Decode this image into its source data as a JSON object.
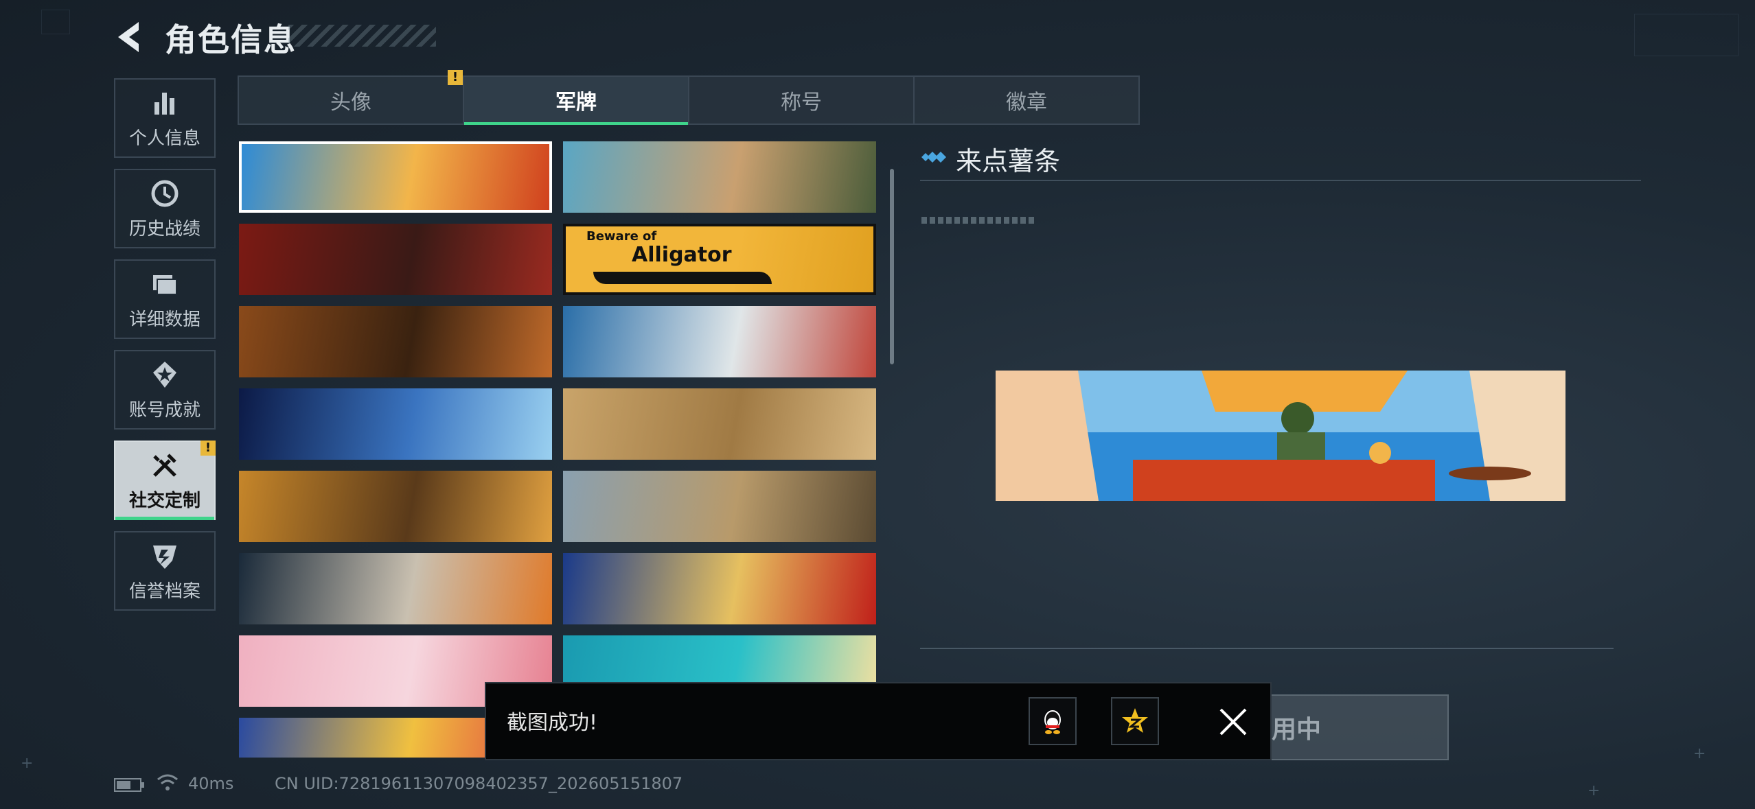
{
  "header": {
    "title": "角色信息"
  },
  "sidebar": {
    "items": [
      {
        "label": "个人信息",
        "icon": "bar-chart-icon"
      },
      {
        "label": "历史战绩",
        "icon": "history-icon"
      },
      {
        "label": "详细数据",
        "icon": "folder-icon"
      },
      {
        "label": "账号成就",
        "icon": "achievement-icon"
      },
      {
        "label": "社交定制",
        "icon": "tools-icon",
        "active": true,
        "alert": "!"
      },
      {
        "label": "信誉档案",
        "icon": "credit-icon"
      }
    ]
  },
  "tabs": [
    {
      "label": "头像",
      "alert": "!"
    },
    {
      "label": "军牌",
      "active": true
    },
    {
      "label": "称号"
    },
    {
      "label": "徽章"
    }
  ],
  "banners": [
    {
      "name": "food-vendor",
      "colors": [
        "#2e8bd6",
        "#f2b54a",
        "#d0411e"
      ]
    },
    {
      "name": "girl-with-gun",
      "colors": [
        "#5aa6c4",
        "#c9a070",
        "#4a5c3a"
      ]
    },
    {
      "name": "red-squad",
      "colors": [
        "#7c1a14",
        "#3a1a16",
        "#9a2a20"
      ]
    },
    {
      "name": "alligator",
      "colors": [
        "#f2b63a",
        "#f2b63a",
        "#e0a020"
      ],
      "line1": "Beware of",
      "line2": "Alligator"
    },
    {
      "name": "autumn-skeleton",
      "colors": [
        "#8a4a1a",
        "#3a2210",
        "#c06a2a"
      ]
    },
    {
      "name": "octopus-wave",
      "colors": [
        "#2a6ea8",
        "#e0e6e8",
        "#c0453a"
      ]
    },
    {
      "name": "cosmic-skeleton",
      "colors": [
        "#0c1a46",
        "#3a74c0",
        "#9ad0f0"
      ]
    },
    {
      "name": "sketch-parchment",
      "colors": [
        "#c9a46a",
        "#a07a44",
        "#d8b882"
      ]
    },
    {
      "name": "feast-soldiers",
      "colors": [
        "#c6862a",
        "#5a3a1a",
        "#e0a040"
      ]
    },
    {
      "name": "sniper-mountain",
      "colors": [
        "#8aa0b0",
        "#b89a6a",
        "#5a4a32"
      ]
    },
    {
      "name": "laser-soldiers",
      "colors": [
        "#1a2a3a",
        "#c9c0b0",
        "#e07a2a"
      ]
    },
    {
      "name": "gold-jewel",
      "colors": [
        "#1a3a8a",
        "#e6c060",
        "#c0201a"
      ]
    },
    {
      "name": "pink-cake",
      "colors": [
        "#f0b0c0",
        "#f6d6de",
        "#e68090"
      ]
    },
    {
      "name": "ocean-boats",
      "colors": [
        "#1a9ab0",
        "#2ac0c8",
        "#f0e0a0"
      ]
    },
    {
      "name": "cartoon-party",
      "colors": [
        "#2a4aa0",
        "#f0c040",
        "#e04040"
      ]
    }
  ],
  "preview": {
    "title": "来点薯条"
  },
  "use_button": {
    "label": "用中"
  },
  "toast": {
    "text": "截图成功!",
    "share": [
      {
        "icon": "qq-icon"
      },
      {
        "icon": "qzone-icon"
      }
    ]
  },
  "status": {
    "ping": "40ms",
    "uid": "CN UID:7281961130709840235​7_202605151807"
  },
  "accent": "#3fd48b",
  "alert_color": "#e8b73a"
}
